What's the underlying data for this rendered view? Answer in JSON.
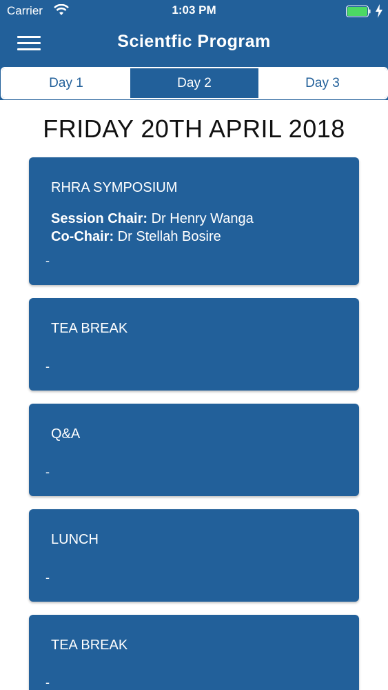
{
  "status_bar": {
    "carrier": "Carrier",
    "time": "1:03 PM",
    "battery_color": "#4cd964"
  },
  "nav": {
    "title": "Scientfic Program",
    "menu_icon": "hamburger-menu-icon"
  },
  "tabs": [
    {
      "label": "Day 1",
      "active": false
    },
    {
      "label": "Day 2",
      "active": true
    },
    {
      "label": "Day 3",
      "active": false
    }
  ],
  "date_heading": "FRIDAY 20TH APRIL 2018",
  "sessions": [
    {
      "title": "RHRA SYMPOSIUM",
      "chair_label": "Session Chair:",
      "chair_name": " Dr Henry Wanga",
      "cochair_label": "Co-Chair:",
      "cochair_name": " Dr Stellah Bosire",
      "detail": "-"
    },
    {
      "title": "TEA BREAK",
      "detail": "-"
    },
    {
      "title": "Q&A",
      "detail": "-"
    },
    {
      "title": "LUNCH",
      "detail": "-"
    },
    {
      "title": "TEA BREAK",
      "detail": "-"
    }
  ],
  "colors": {
    "primary": "#22609a",
    "background": "#ffffff",
    "text_dark": "#111111"
  }
}
